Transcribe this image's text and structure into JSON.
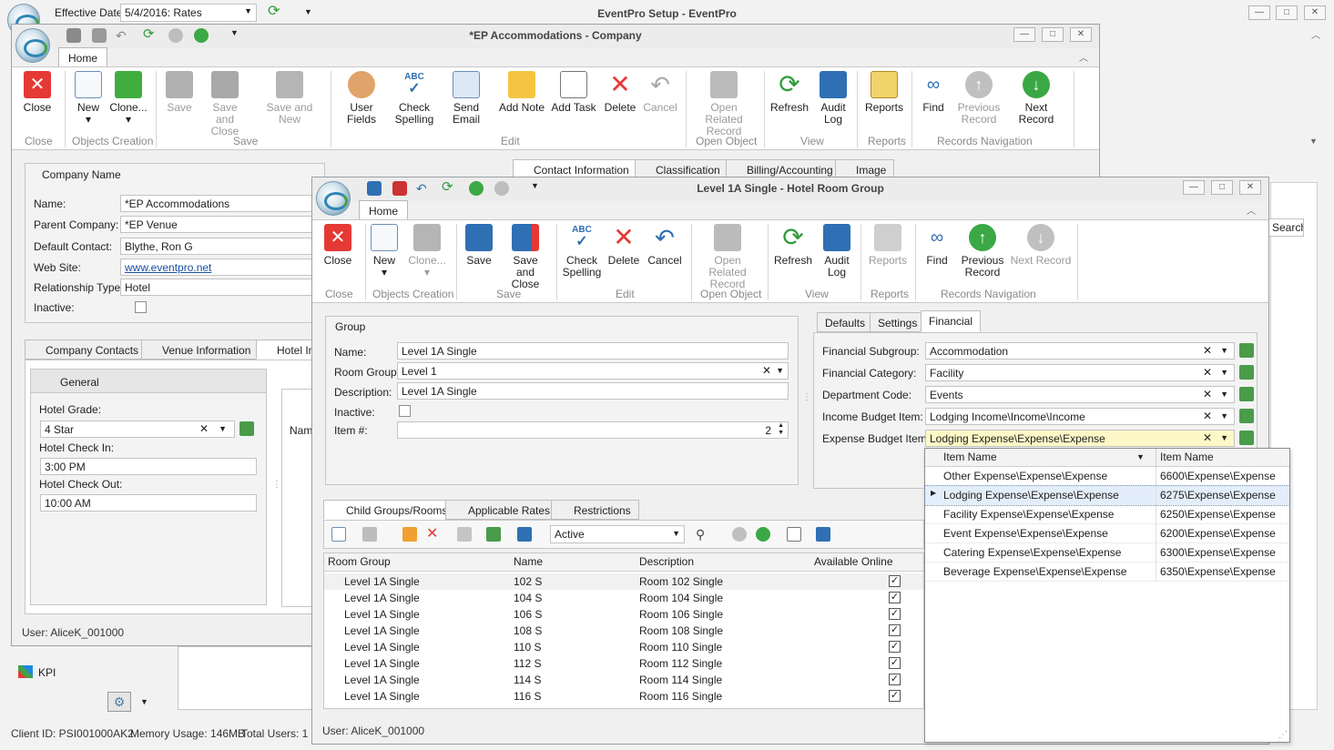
{
  "main_window": {
    "title": "EventPro Setup - EventPro",
    "effective_date_label": "Effective Date",
    "effective_date_value": "5/4/2016: Rates"
  },
  "company_window": {
    "title": "*EP Accommodations - Company",
    "tab_home": "Home",
    "ribbon": {
      "close": "Close",
      "new": "New",
      "clone": "Clone...",
      "save": "Save",
      "save_and_close": "Save and Close",
      "save_and_new": "Save and New",
      "user_fields": "User Fields",
      "check_spelling": "Check Spelling",
      "send_email": "Send Email",
      "add_note": "Add Note",
      "add_task": "Add Task",
      "delete": "Delete",
      "cancel": "Cancel",
      "open_related_record": "Open Related Record",
      "refresh": "Refresh",
      "audit_log": "Audit Log",
      "reports": "Reports",
      "find": "Find",
      "previous_record": "Previous Record",
      "next_record": "Next Record"
    },
    "groups": {
      "close": "Close",
      "objects_creation": "Objects Creation",
      "save": "Save",
      "edit": "Edit",
      "open_object": "Open Object",
      "view": "View",
      "reports": "Reports",
      "records_navigation": "Records Navigation"
    },
    "company_name_header": "Company Name",
    "fields": {
      "name_label": "Name:",
      "name_value": "*EP Accommodations",
      "parent_label": "Parent Company:",
      "parent_value": "*EP Venue",
      "contact_label": "Default Contact:",
      "contact_value": "Blythe, Ron G",
      "web_label": "Web Site:",
      "web_value": "www.eventpro.net",
      "rel_label": "Relationship Type:",
      "rel_value": "Hotel",
      "inactive_label": "Inactive:"
    },
    "top_tabs": [
      "Contact Information",
      "Classification",
      "Billing/Accounting",
      "Image"
    ],
    "lower_tabs": [
      "Company Contacts",
      "Venue Information",
      "Hotel In"
    ],
    "general_header": "General",
    "hotel_grade_label": "Hotel Grade:",
    "hotel_grade_value": "4 Star",
    "check_in_label": "Hotel Check In:",
    "check_in_value": "3:00 PM",
    "check_out_label": "Hotel Check Out:",
    "check_out_value": "10:00 AM",
    "name_col_partial": "Name",
    "user": "User: AliceK_001000"
  },
  "background": {
    "kpi": "KPI",
    "search": "Search",
    "client_id": "Client ID: PSI001000AK2",
    "memory": "Memory Usage: 146MB",
    "total_users": "Total Users: 1"
  },
  "room_window": {
    "title": "Level 1A Single - Hotel Room Group",
    "tab_home": "Home",
    "ribbon": {
      "close": "Close",
      "new": "New",
      "clone": "Clone...",
      "save": "Save",
      "save_and_close": "Save and Close",
      "check_spelling": "Check Spelling",
      "delete": "Delete",
      "cancel": "Cancel",
      "open_related_record": "Open Related Record",
      "refresh": "Refresh",
      "audit_log": "Audit Log",
      "reports": "Reports",
      "find": "Find",
      "previous_record": "Previous Record",
      "next_record": "Next Record"
    },
    "groups": {
      "close": "Close",
      "objects_creation": "Objects Creation",
      "save": "Save",
      "edit": "Edit",
      "open_object": "Open Object",
      "view": "View",
      "reports": "Reports",
      "records_navigation": "Records Navigation"
    },
    "group_header": "Group",
    "fields": {
      "name_label": "Name:",
      "name_value": "Level 1A Single",
      "room_group_label": "Room Group:",
      "room_group_value": "Level 1",
      "description_label": "Description:",
      "description_value": "Level 1A Single",
      "inactive_label": "Inactive:",
      "item_label": "Item #:",
      "item_value": "2"
    },
    "right_tabs": [
      "Defaults",
      "Settings",
      "Financial"
    ],
    "financial": {
      "subgroup_label": "Financial Subgroup:",
      "subgroup_value": "Accommodation",
      "category_label": "Financial Category:",
      "category_value": "Facility",
      "dept_label": "Department Code:",
      "dept_value": "Events",
      "income_label": "Income Budget Item:",
      "income_value": "Lodging Income\\Income\\Income",
      "expense_label": "Expense Budget Item:",
      "expense_value": "Lodging Expense\\Expense\\Expense"
    },
    "dropdown": {
      "col1": "Item Name",
      "col2": "Item Name",
      "rows": [
        {
          "name": "Other Expense\\Expense\\Expense",
          "code": "6600\\Expense\\Expense"
        },
        {
          "name": "Lodging Expense\\Expense\\Expense",
          "code": "6275\\Expense\\Expense"
        },
        {
          "name": "Facility Expense\\Expense\\Expense",
          "code": "6250\\Expense\\Expense"
        },
        {
          "name": "Event Expense\\Expense\\Expense",
          "code": "6200\\Expense\\Expense"
        },
        {
          "name": "Catering Expense\\Expense\\Expense",
          "code": "6300\\Expense\\Expense"
        },
        {
          "name": "Beverage Expense\\Expense\\Expense",
          "code": "6350\\Expense\\Expense"
        }
      ]
    },
    "bottom_tabs": [
      "Child Groups/Rooms",
      "Applicable Rates",
      "Restrictions"
    ],
    "filter_value": "Active",
    "grid": {
      "headers": [
        "Room Group",
        "Name",
        "Description",
        "Available Online"
      ],
      "rows": [
        {
          "group": "Level 1A Single",
          "name": "102 S",
          "desc": "Room 102 Single"
        },
        {
          "group": "Level 1A Single",
          "name": "104 S",
          "desc": "Room 104 Single"
        },
        {
          "group": "Level 1A Single",
          "name": "106 S",
          "desc": "Room 106 Single"
        },
        {
          "group": "Level 1A Single",
          "name": "108 S",
          "desc": "Room 108 Single"
        },
        {
          "group": "Level 1A Single",
          "name": "110 S",
          "desc": "Room 110 Single"
        },
        {
          "group": "Level 1A Single",
          "name": "112 S",
          "desc": "Room 112 Single"
        },
        {
          "group": "Level 1A Single",
          "name": "114 S",
          "desc": "Room 114 Single"
        },
        {
          "group": "Level 1A Single",
          "name": "116 S",
          "desc": "Room 116 Single"
        }
      ]
    },
    "user": "User: AliceK_001000"
  }
}
